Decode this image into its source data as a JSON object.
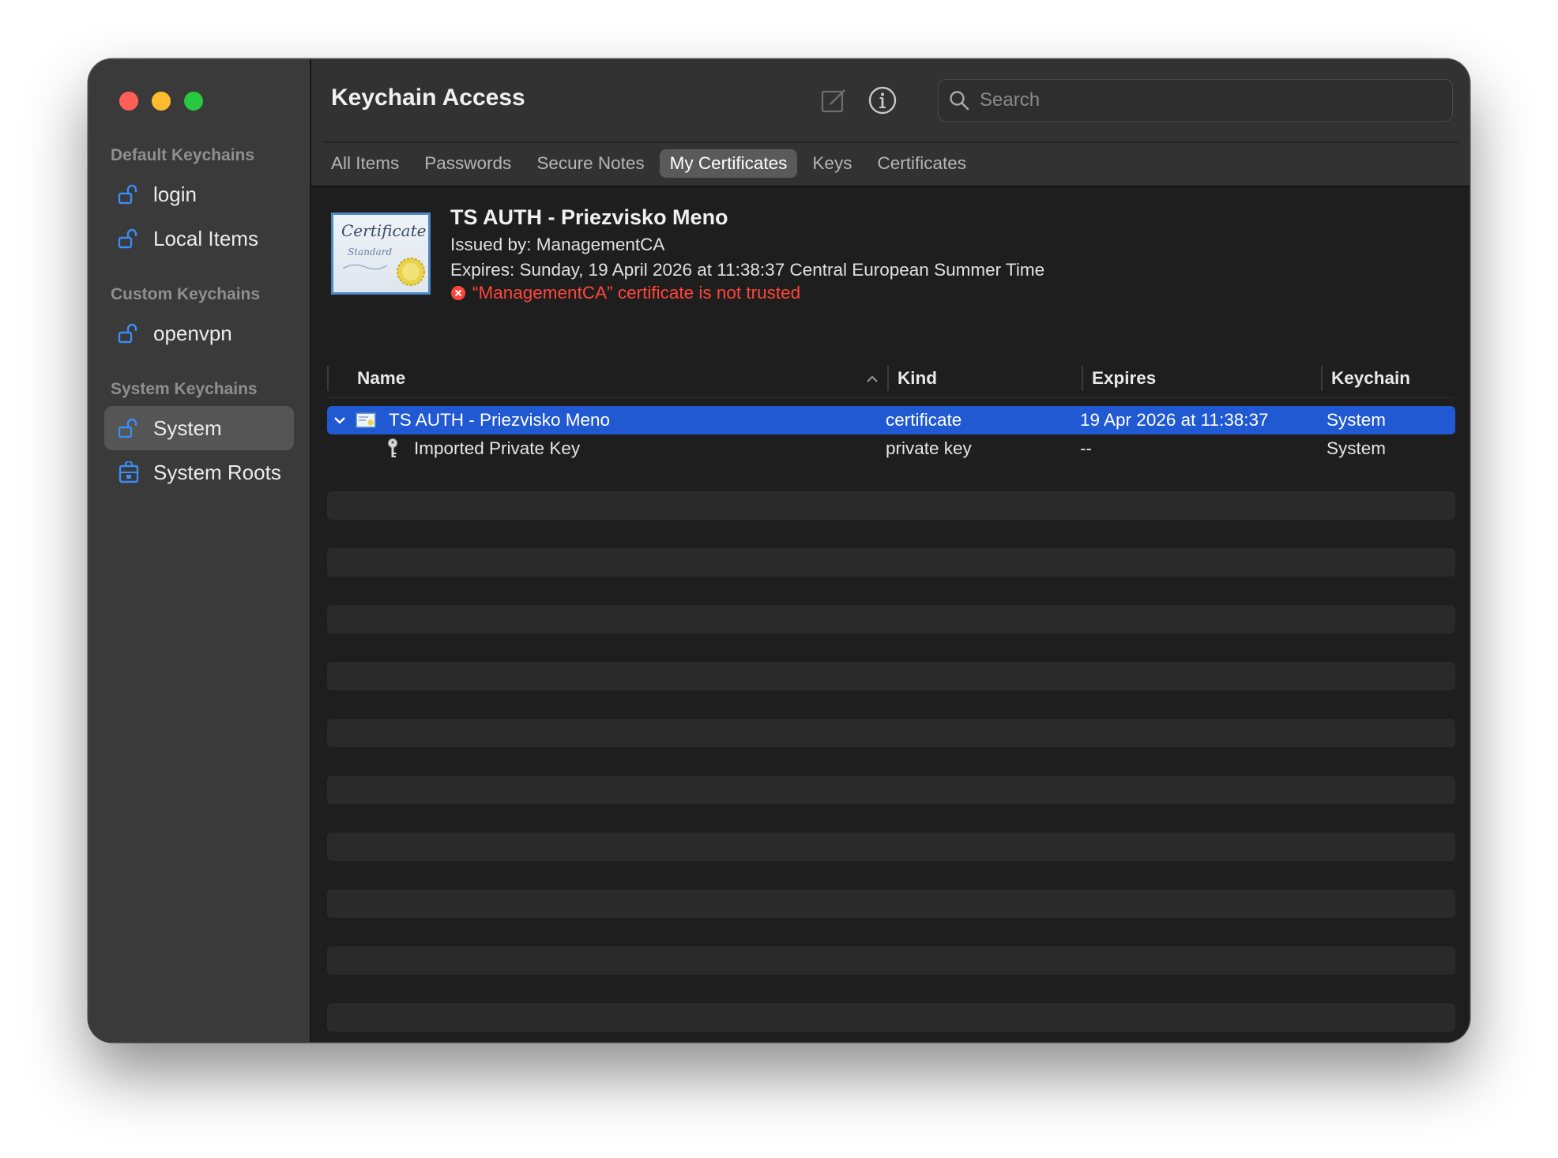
{
  "window": {
    "title": "Keychain Access"
  },
  "sidebar": {
    "sections": [
      {
        "title": "Default Keychains",
        "items": [
          {
            "label": "login",
            "icon": "unlocked-padlock-icon"
          },
          {
            "label": "Local Items",
            "icon": "unlocked-padlock-icon"
          }
        ]
      },
      {
        "title": "Custom Keychains",
        "items": [
          {
            "label": "openvpn",
            "icon": "unlocked-padlock-icon"
          }
        ]
      },
      {
        "title": "System Keychains",
        "items": [
          {
            "label": "System",
            "icon": "unlocked-padlock-icon",
            "selected": true
          },
          {
            "label": "System Roots",
            "icon": "locked-cabinet-icon"
          }
        ]
      }
    ]
  },
  "toolbar": {
    "compose_icon": "compose-icon",
    "info_icon": "info-icon",
    "search_placeholder": "Search"
  },
  "tabs": [
    {
      "label": "All Items",
      "active": false
    },
    {
      "label": "Passwords",
      "active": false
    },
    {
      "label": "Secure Notes",
      "active": false
    },
    {
      "label": "My Certificates",
      "active": true
    },
    {
      "label": "Keys",
      "active": false
    },
    {
      "label": "Certificates",
      "active": false
    }
  ],
  "preview": {
    "cert_image_text": "Certificate",
    "cert_image_subtext": "Standard",
    "title": "TS AUTH - Priezvisko Meno",
    "issued_by": "Issued by: ManagementCA",
    "expires": "Expires: Sunday, 19 April 2026 at 11:38:37 Central European Summer Time",
    "warning": "“ManagementCA” certificate is not trusted"
  },
  "table": {
    "columns": [
      "Name",
      "Kind",
      "Expires",
      "Keychain"
    ],
    "sort": {
      "column": "Name",
      "direction": "ascending"
    },
    "rows": [
      {
        "name": "TS AUTH - Priezvisko Meno",
        "kind": "certificate",
        "expires": "19 Apr 2026 at 11:38:37",
        "keychain": "System",
        "icon": "certificate-icon",
        "expanded": true,
        "selected": true
      },
      {
        "name": "Imported Private Key",
        "kind": "private key",
        "expires": "--",
        "keychain": "System",
        "icon": "key-icon",
        "selected": false
      }
    ]
  },
  "colors": {
    "selection": "#2159d2",
    "warning": "#ff453a",
    "sidebar_icon": "#3b8cf5"
  }
}
